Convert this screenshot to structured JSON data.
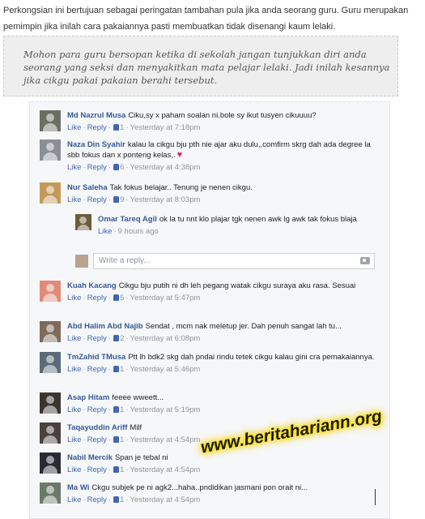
{
  "article": {
    "intro": "Perkongsian ini bertujuan sebagai peringatan tambahan pula jika anda seorang guru. Guru merupakan pemimpin jika inilah cara pakaiannya pasti membuatkan tidak disenangi kaum lelaki.",
    "quote": "Mohon para guru bersopan ketika di sekolah jangan tunjukkan diri anda seorang yang seksi dan menyakitkan mata pelajar lelaki. Jadi inilah kesannya jika cikgu pakai pakaian berahi tersebut."
  },
  "ui": {
    "like_label": "Like",
    "reply_label": "Reply",
    "reply_placeholder": "Write a reply..."
  },
  "comments": [
    {
      "author": "Md Nazrul Musa",
      "text": "Ciku,sy x paham soalan ni.bole sy ikut tusyen cikuuuu?",
      "likes": "1",
      "time": "Yesterday at 7:18pm",
      "avatar_color": "#6b6f62"
    },
    {
      "author": "Naza Din Syahir",
      "text": "kalau la cikgu bju pth nie ajar aku dulu,,comfirm skrg dah ada degree la sbb fokus dan x ponteng kelas,.",
      "likes": "6",
      "time": "Yesterday at 4:38pm",
      "avatar_color": "#8a8f96"
    },
    {
      "author": "Nur Saleha",
      "text": "Tak fokus belajar.. Tenung je nenen cikgu.",
      "likes": "9",
      "time": "Yesterday at 8:03pm",
      "avatar_color": "#c49a5a"
    },
    {
      "author": "Omar Tareq Agil",
      "text": "ok la tu nnt klo plajar tgk nenen awk lg awk tak fokus blaja",
      "time": "9 hours ago",
      "avatar_color": "#6b5d3a"
    },
    {
      "author": "Kuah Kacang",
      "text": "Cikgu bju putih ni dh leh pegang watak cikgu suraya aku rasa. Sesuai",
      "likes": "5",
      "time": "Yesterday at 5:47pm",
      "avatar_color": "#e08a7a"
    },
    {
      "author": "Abd Halim Abd Najib",
      "text": "Sendat , mcm nak meletup jer. Dah penuh sangat lah tu...",
      "likes": "2",
      "time": "Yesterday at 6:08pm",
      "avatar_color": "#7d6a5a"
    },
    {
      "author": "TmZahid TMusa",
      "text": "Ptt lh bdk2 skg dah pndai rindu tetek cikgu kalau gini cra pemakaiannya.",
      "likes": "1",
      "time": "Yesterday at 5:46pm",
      "avatar_color": "#5a6a7a"
    },
    {
      "author": "Asap Hitam",
      "text": "feeee wweett...",
      "likes": "1",
      "time": "Yesterday at 5:19pm",
      "avatar_color": "#3a3530"
    },
    {
      "author": "Taqayuddin Ariff",
      "text": "Milf",
      "likes": "1",
      "time": "Yesterday at 4:54pm",
      "avatar_color": "#4a4040"
    },
    {
      "author": "Nabil Mercik",
      "text": "Span je tebal ni",
      "likes": "1",
      "time": "Yesterday at 4:54pm",
      "avatar_color": "#2a2a35"
    },
    {
      "author": "Ma Wi",
      "text": "Ckgu subjek pe ni agk2...haha..pndidikan jasmani pon orait ni...",
      "likes": "1",
      "time": "Yesterday at 4:54pm",
      "avatar_color": "#6a7a6a"
    }
  ],
  "watermark": "www.beritahariann.org"
}
